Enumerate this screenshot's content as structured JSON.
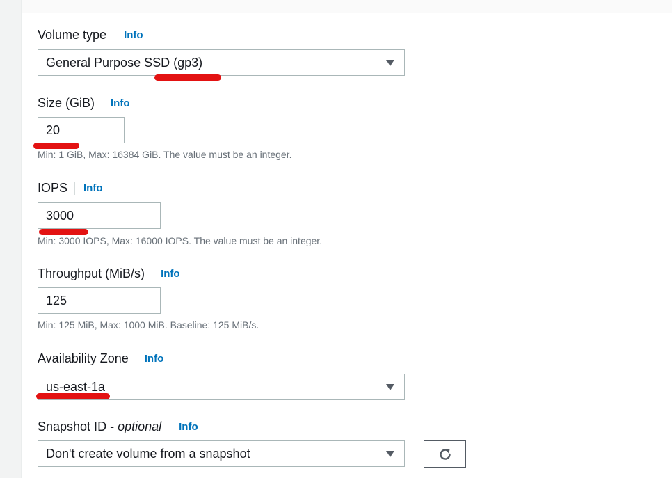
{
  "volume_type": {
    "label": "Volume type",
    "info": "Info",
    "value": "General Purpose SSD (gp3)"
  },
  "size": {
    "label": "Size (GiB)",
    "info": "Info",
    "value": "20",
    "hint": "Min: 1 GiB, Max: 16384 GiB. The value must be an integer."
  },
  "iops": {
    "label": "IOPS",
    "info": "Info",
    "value": "3000",
    "hint": "Min: 3000 IOPS, Max: 16000 IOPS. The value must be an integer."
  },
  "throughput": {
    "label": "Throughput (MiB/s)",
    "info": "Info",
    "value": "125",
    "hint": "Min: 125 MiB, Max: 1000 MiB. Baseline: 125 MiB/s."
  },
  "availability_zone": {
    "label": "Availability Zone",
    "info": "Info",
    "value": "us-east-1a"
  },
  "snapshot": {
    "label": "Snapshot ID - ",
    "label_optional": "optional",
    "info": "Info",
    "value": "Don't create volume from a snapshot"
  },
  "colors": {
    "link": "#0073bb",
    "annotation": "#e31212",
    "border": "#aab7b8"
  },
  "icons": {
    "dropdown": "caret-down-icon",
    "refresh": "refresh-icon"
  }
}
